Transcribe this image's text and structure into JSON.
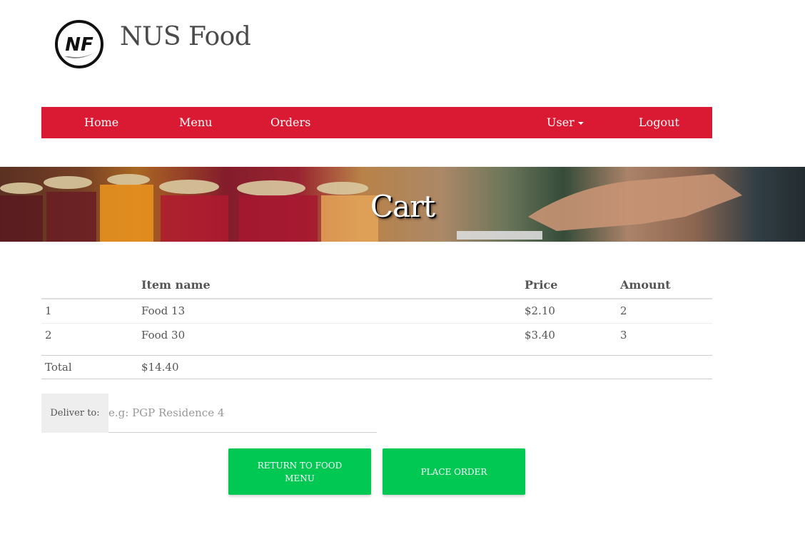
{
  "brand": {
    "logo_text": "NF",
    "title": "NUS Food"
  },
  "nav": {
    "home": "Home",
    "menu": "Menu",
    "orders": "Orders",
    "user": "User",
    "logout": "Logout"
  },
  "banner": {
    "title": "Cart"
  },
  "cart": {
    "headers": [
      "",
      "Item name",
      "Price",
      "Amount"
    ],
    "rows": [
      [
        "1",
        "Food 13",
        "$2.10",
        "2"
      ],
      [
        "2",
        "Food 30",
        "$3.40",
        "3"
      ]
    ],
    "total_label": "Total",
    "total_value": "$14.40"
  },
  "deliver": {
    "label": "Deliver to:",
    "placeholder": "e.g: PGP Residence 4",
    "value": ""
  },
  "buttons": {
    "return": "RETURN TO FOOD MENU",
    "place": "PLACE ORDER"
  },
  "colors": {
    "nav_bg": "#da1a32",
    "button_bg": "#00c853"
  }
}
